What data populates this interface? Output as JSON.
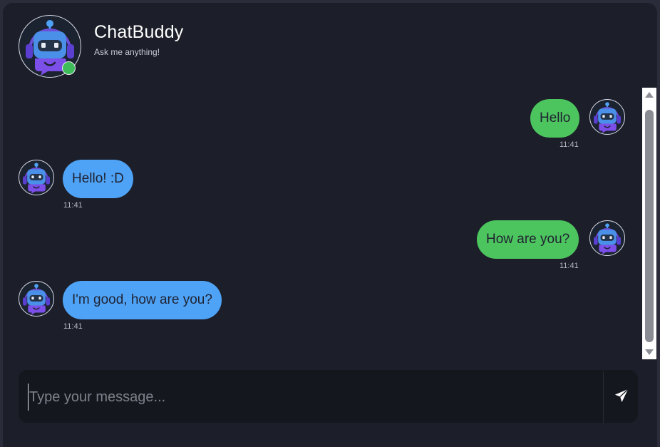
{
  "header": {
    "title": "ChatBuddy",
    "subtitle": "Ask me anything!",
    "avatar_icon": "robot-icon",
    "status": "online"
  },
  "messages": [
    {
      "sender": "user",
      "text": "Hello",
      "time": "11:41"
    },
    {
      "sender": "bot",
      "text": "Hello! :D",
      "time": "11:41"
    },
    {
      "sender": "user",
      "text": "How are you?",
      "time": "11:41"
    },
    {
      "sender": "bot",
      "text": "I'm good, how are you?",
      "time": "11:41"
    }
  ],
  "composer": {
    "placeholder": "Type your message...",
    "value": "",
    "send_icon": "send-icon"
  },
  "colors": {
    "user_bubble": "#4dc55f",
    "bot_bubble": "#4fa3f7",
    "online": "#3fbd5a",
    "background": "#1c1f29"
  }
}
